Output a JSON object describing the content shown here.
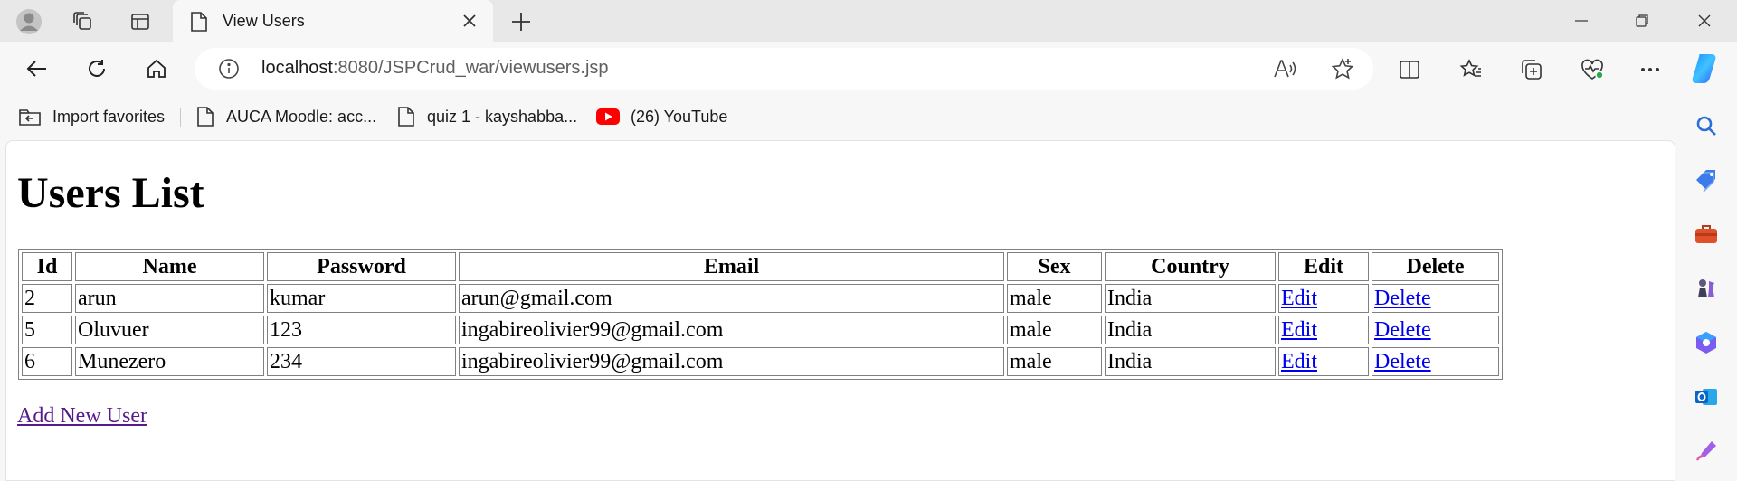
{
  "browser": {
    "tab": {
      "title": "View Users"
    },
    "address": {
      "host": "localhost",
      "path": ":8080/JSPCrud_war/viewusers.jsp"
    },
    "bookmarks": [
      {
        "label": "Import favorites",
        "icon": "folder-icon"
      },
      {
        "label": "AUCA Moodle: acc...",
        "icon": "page-icon"
      },
      {
        "label": "quiz 1 - kayshabba...",
        "icon": "page-icon"
      },
      {
        "label": "(26) YouTube",
        "icon": "youtube-icon"
      }
    ],
    "colors": {
      "chrome": "#f7f7f7",
      "tabstrip": "#e8e8e8",
      "youtube": "#ff0000",
      "link": "#0000ee",
      "visited_link": "#551a8b"
    }
  },
  "page": {
    "title": "Users List",
    "table": {
      "headers": [
        "Id",
        "Name",
        "Password",
        "Email",
        "Sex",
        "Country",
        "Edit",
        "Delete"
      ],
      "rows": [
        {
          "id": "2",
          "name": "arun",
          "password": "kumar",
          "email": "arun@gmail.com",
          "sex": "male",
          "country": "India",
          "edit": "Edit",
          "delete": "Delete"
        },
        {
          "id": "5",
          "name": "Oluvuer",
          "password": "123",
          "email": "ingabireolivier99@gmail.com",
          "sex": "male",
          "country": "India",
          "edit": "Edit",
          "delete": "Delete"
        },
        {
          "id": "6",
          "name": "Munezero",
          "password": "234",
          "email": "ingabireolivier99@gmail.com",
          "sex": "male",
          "country": "India",
          "edit": "Edit",
          "delete": "Delete"
        }
      ]
    },
    "add_link": "Add New User"
  }
}
